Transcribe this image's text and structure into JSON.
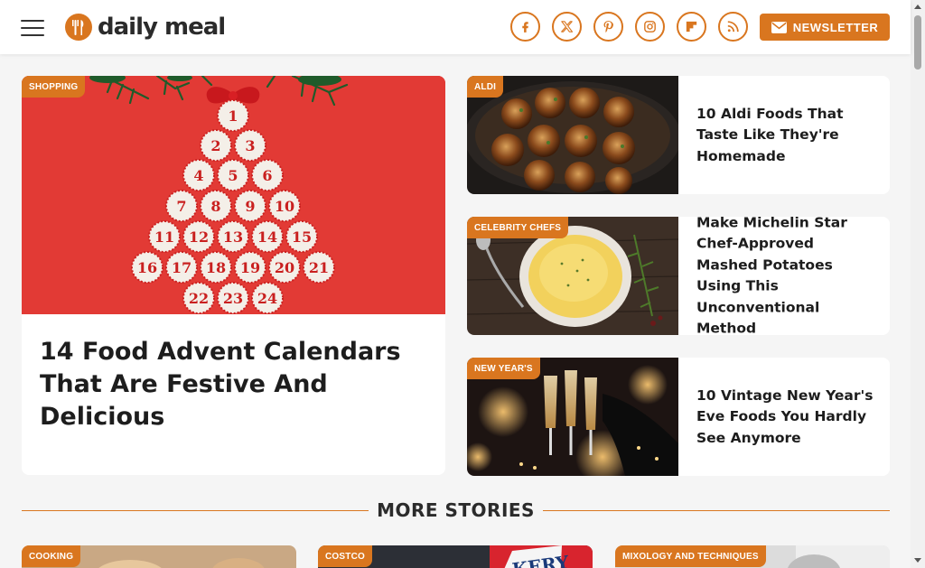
{
  "header": {
    "logo_text": "daily meal",
    "newsletter_label": "NEWSLETTER",
    "socials": [
      "facebook-icon",
      "x-icon",
      "pinterest-icon",
      "instagram-icon",
      "flipboard-icon",
      "rss-icon"
    ]
  },
  "colors": {
    "accent": "#d9761f",
    "hero_background": "#e23a35"
  },
  "hero": {
    "tag": "SHOPPING",
    "title": "14 Food Advent Calendars That Are Festive And Delicious",
    "calendar_numbers": [
      "1",
      "2",
      "3",
      "4",
      "5",
      "6",
      "7",
      "8",
      "9",
      "10",
      "11",
      "12",
      "13",
      "14",
      "15",
      "16",
      "17",
      "18",
      "19",
      "20",
      "21",
      "22",
      "23",
      "24"
    ]
  },
  "side_stories": [
    {
      "tag": "ALDI",
      "title": "10 Aldi Foods That Taste Like They're Homemade"
    },
    {
      "tag": "CELEBRITY CHEFS",
      "title": "Make Michelin Star Chef-Approved Mashed Potatoes Using This Unconventional Method"
    },
    {
      "tag": "NEW YEAR'S",
      "title": "10 Vintage New Year's Eve Foods You Hardly See Anymore"
    }
  ],
  "more_stories": {
    "heading": "MORE STORIES",
    "cards": [
      {
        "tag": "COOKING"
      },
      {
        "tag": "COSTCO"
      },
      {
        "tag": "MIXOLOGY AND TECHNIQUES"
      }
    ],
    "costco_sign_text": "KERY"
  }
}
